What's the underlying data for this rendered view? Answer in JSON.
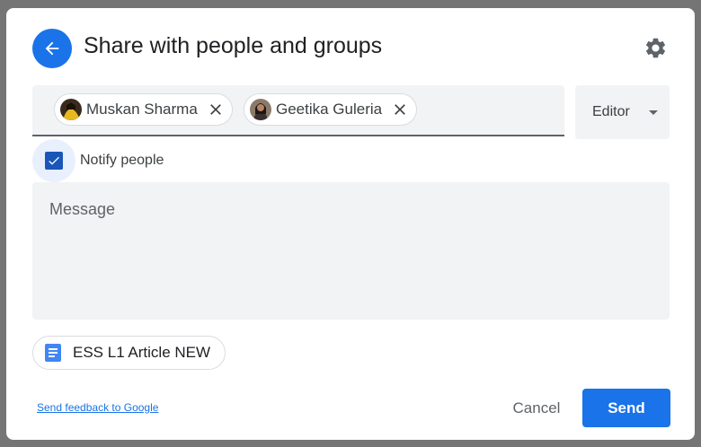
{
  "dialog": {
    "title": "Share with people and groups",
    "back_icon": "arrow-left-icon",
    "settings_icon": "gear-icon"
  },
  "recipients": [
    {
      "name": "Muskan Sharma",
      "remove_icon": "close-icon"
    },
    {
      "name": "Geetika Guleria",
      "remove_icon": "close-icon"
    }
  ],
  "role": {
    "selected": "Editor",
    "icon": "caret-down-icon"
  },
  "notify": {
    "label": "Notify people",
    "checked": true
  },
  "message": {
    "placeholder": "Message"
  },
  "attachment": {
    "name": "ESS L1 Article NEW",
    "icon": "google-docs-icon"
  },
  "footer": {
    "feedback_link": "Send feedback to Google",
    "cancel_label": "Cancel",
    "send_label": "Send"
  },
  "colors": {
    "accent": "#1a73e8",
    "field_background": "#f1f3f4",
    "checkbox": "#1a56b8"
  }
}
